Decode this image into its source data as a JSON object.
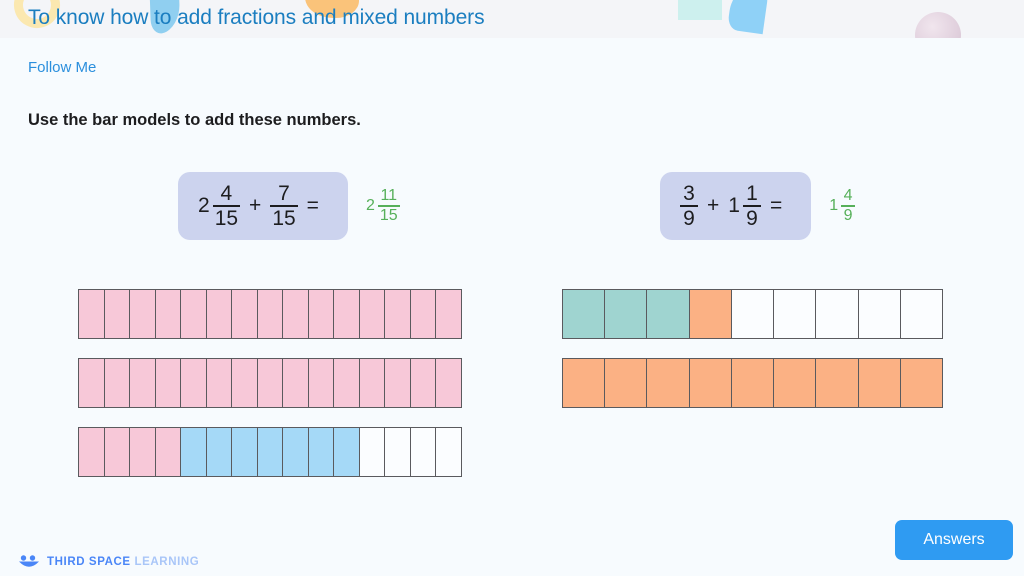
{
  "header": {
    "title": "To know how to add fractions and mixed numbers",
    "title_color": "#1b7ec0",
    "band_color": "#f4f5f8",
    "decorations": [
      {
        "name": "crescent",
        "color": "#fbe7ac"
      },
      {
        "name": "swoosh",
        "color": "#7ec8ee"
      },
      {
        "name": "blob",
        "color": "#fbbe6c"
      },
      {
        "name": "arc-mint",
        "color": "#cdf0ee"
      },
      {
        "name": "arc-blue",
        "color": "#8fd1f7"
      },
      {
        "name": "sphere",
        "color": "#ddc9d8"
      }
    ]
  },
  "subtitle": "Follow Me",
  "instruction": "Use the bar models to add these numbers.",
  "page_background": "#f7fbfe",
  "colors": {
    "equation_box": "#ccd3ee",
    "answer_green": "#57b05a",
    "pink": "#f7c8d8",
    "blue": "#a5d9f7",
    "teal": "#9fd4d0",
    "orange": "#fbb184",
    "empty": "#fbfdff",
    "cell_border": "#5a5a5e",
    "accent_blue": "#2f9bf2"
  },
  "problems": [
    {
      "id": "problem-1",
      "equation": {
        "term1": {
          "whole": "2",
          "numerator": "4",
          "denominator": "15"
        },
        "operator": "+",
        "term2": {
          "whole": "",
          "numerator": "7",
          "denominator": "15"
        },
        "equals": "="
      },
      "answer": {
        "whole": "2",
        "numerator": "11",
        "denominator": "15"
      },
      "bars": [
        {
          "cells": 15,
          "fill": [
            "pink",
            "pink",
            "pink",
            "pink",
            "pink",
            "pink",
            "pink",
            "pink",
            "pink",
            "pink",
            "pink",
            "pink",
            "pink",
            "pink",
            "pink"
          ]
        },
        {
          "cells": 15,
          "fill": [
            "pink",
            "pink",
            "pink",
            "pink",
            "pink",
            "pink",
            "pink",
            "pink",
            "pink",
            "pink",
            "pink",
            "pink",
            "pink",
            "pink",
            "pink"
          ]
        },
        {
          "cells": 15,
          "fill": [
            "pink",
            "pink",
            "pink",
            "pink",
            "blue",
            "blue",
            "blue",
            "blue",
            "blue",
            "blue",
            "blue",
            "empty",
            "empty",
            "empty",
            "empty"
          ]
        }
      ]
    },
    {
      "id": "problem-2",
      "equation": {
        "term1": {
          "whole": "",
          "numerator": "3",
          "denominator": "9"
        },
        "operator": "+",
        "term2": {
          "whole": "1",
          "numerator": "1",
          "denominator": "9"
        },
        "equals": "="
      },
      "answer": {
        "whole": "1",
        "numerator": "4",
        "denominator": "9"
      },
      "bars": [
        {
          "cells": 9,
          "fill": [
            "teal",
            "teal",
            "teal",
            "orange",
            "empty",
            "empty",
            "empty",
            "empty",
            "empty"
          ]
        },
        {
          "cells": 9,
          "fill": [
            "orange",
            "orange",
            "orange",
            "orange",
            "orange",
            "orange",
            "orange",
            "orange",
            "orange"
          ]
        }
      ]
    }
  ],
  "footer": {
    "brand_strong": "THIRD SPACE",
    "brand_light": "LEARNING",
    "answers_label": "Answers"
  }
}
